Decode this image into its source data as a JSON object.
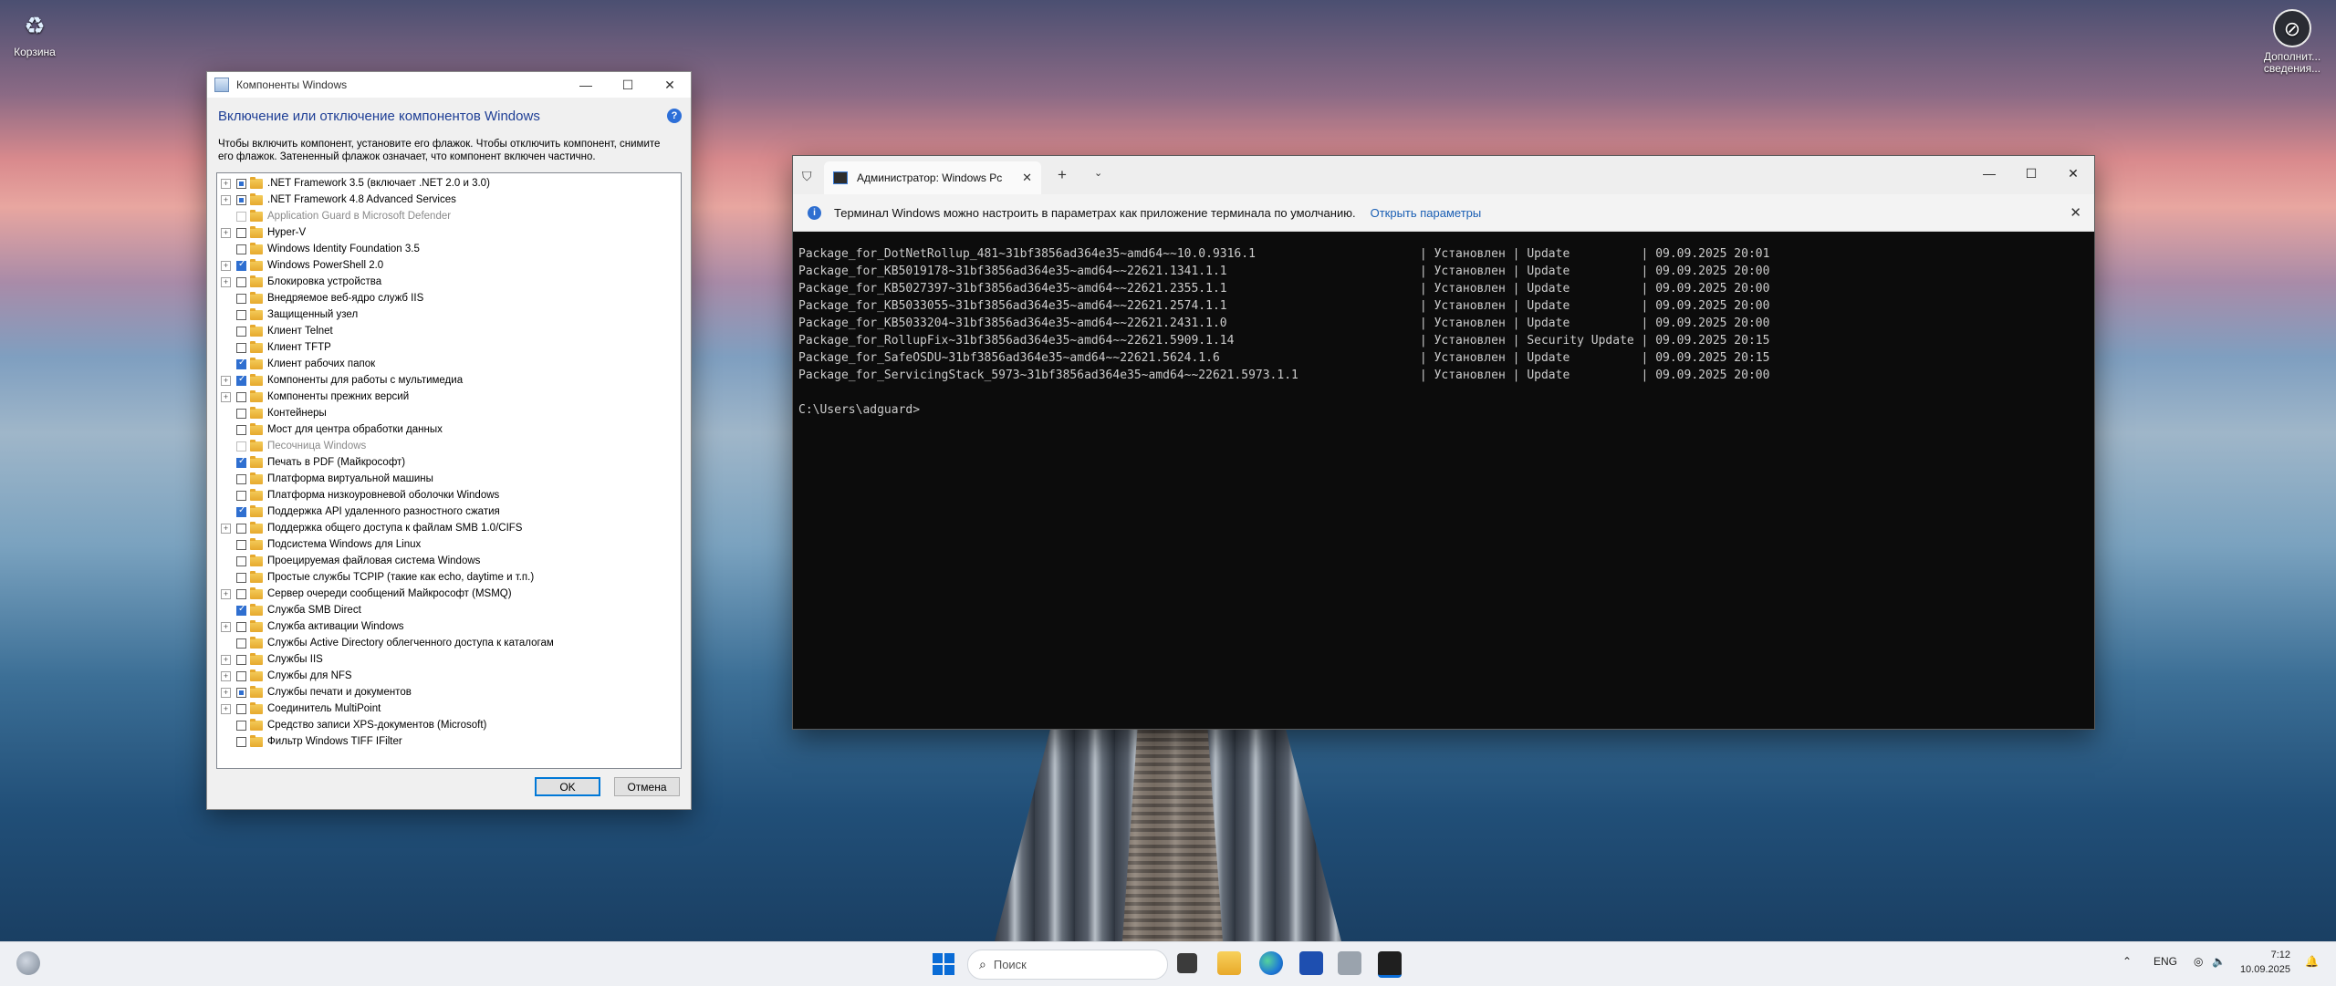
{
  "desktop": {
    "icons": [
      {
        "label": "Корзина"
      },
      {
        "label": "Дополнит... сведения..."
      }
    ]
  },
  "features_dialog": {
    "title": "Компоненты Windows",
    "heading": "Включение или отключение компонентов Windows",
    "description": "Чтобы включить компонент, установите его флажок. Чтобы отключить компонент, снимите его флажок. Затененный флажок означает, что компонент включен частично.",
    "help_glyph": "?",
    "items": [
      {
        "label": ".NET Framework 3.5 (включает .NET 2.0 и 3.0)",
        "state": "partial",
        "expandable": true
      },
      {
        "label": ".NET Framework 4.8 Advanced Services",
        "state": "partial",
        "expandable": true
      },
      {
        "label": "Application Guard в Microsoft Defender",
        "state": "disabled",
        "expandable": false
      },
      {
        "label": "Hyper-V",
        "state": "unchecked",
        "expandable": true
      },
      {
        "label": "Windows Identity Foundation 3.5",
        "state": "unchecked",
        "expandable": false
      },
      {
        "label": "Windows PowerShell 2.0",
        "state": "checked",
        "expandable": true
      },
      {
        "label": "Блокировка устройства",
        "state": "unchecked",
        "expandable": true
      },
      {
        "label": "Внедряемое веб-ядро служб IIS",
        "state": "unchecked",
        "expandable": false
      },
      {
        "label": "Защищенный узел",
        "state": "unchecked",
        "expandable": false
      },
      {
        "label": "Клиент Telnet",
        "state": "unchecked",
        "expandable": false
      },
      {
        "label": "Клиент TFTP",
        "state": "unchecked",
        "expandable": false
      },
      {
        "label": "Клиент рабочих папок",
        "state": "checked",
        "expandable": false
      },
      {
        "label": "Компоненты для работы с мультимедиа",
        "state": "checked",
        "expandable": true
      },
      {
        "label": "Компоненты прежних версий",
        "state": "unchecked",
        "expandable": true
      },
      {
        "label": "Контейнеры",
        "state": "unchecked",
        "expandable": false
      },
      {
        "label": "Мост для центра обработки данных",
        "state": "unchecked",
        "expandable": false
      },
      {
        "label": "Песочница Windows",
        "state": "disabled",
        "expandable": false
      },
      {
        "label": "Печать в PDF (Майкрософт)",
        "state": "checked",
        "expandable": false
      },
      {
        "label": "Платформа виртуальной машины",
        "state": "unchecked",
        "expandable": false
      },
      {
        "label": "Платформа низкоуровневой оболочки Windows",
        "state": "unchecked",
        "expandable": false
      },
      {
        "label": "Поддержка API удаленного разностного сжатия",
        "state": "checked",
        "expandable": false
      },
      {
        "label": "Поддержка общего доступа к файлам SMB 1.0/CIFS",
        "state": "unchecked",
        "expandable": true
      },
      {
        "label": "Подсистема Windows для Linux",
        "state": "unchecked",
        "expandable": false
      },
      {
        "label": "Проецируемая файловая система Windows",
        "state": "unchecked",
        "expandable": false
      },
      {
        "label": "Простые службы TCPIP (такие как echo, daytime и т.п.)",
        "state": "unchecked",
        "expandable": false
      },
      {
        "label": "Сервер очереди сообщений Майкрософт (MSMQ)",
        "state": "unchecked",
        "expandable": true
      },
      {
        "label": "Служба SMB Direct",
        "state": "checked",
        "expandable": false
      },
      {
        "label": "Служба активации Windows",
        "state": "unchecked",
        "expandable": true
      },
      {
        "label": "Службы Active Directory облегченного доступа к каталогам",
        "state": "unchecked",
        "expandable": false
      },
      {
        "label": "Службы IIS",
        "state": "unchecked",
        "expandable": true
      },
      {
        "label": "Службы для NFS",
        "state": "unchecked",
        "expandable": true
      },
      {
        "label": "Службы печати и документов",
        "state": "partial",
        "expandable": true
      },
      {
        "label": "Соединитель MultiPoint",
        "state": "unchecked",
        "expandable": true
      },
      {
        "label": "Средство записи XPS-документов (Microsoft)",
        "state": "unchecked",
        "expandable": false
      },
      {
        "label": "Фильтр Windows TIFF IFilter",
        "state": "unchecked",
        "expandable": false
      }
    ],
    "ok_label": "OK",
    "cancel_label": "Отмена"
  },
  "terminal": {
    "tab_title": "Администратор: Windows Pc",
    "info_message": "Терминал Windows можно настроить в параметрах как приложение терминала по умолчанию.",
    "info_link": "Открыть параметры",
    "lines": [
      "Package_for_DotNetRollup_481~31bf3856ad364e35~amd64~~10.0.9316.1                       | Установлен | Update          | 09.09.2025 20:01",
      "Package_for_KB5019178~31bf3856ad364e35~amd64~~22621.1341.1.1                           | Установлен | Update          | 09.09.2025 20:00",
      "Package_for_KB5027397~31bf3856ad364e35~amd64~~22621.2355.1.1                           | Установлен | Update          | 09.09.2025 20:00",
      "Package_for_KB5033055~31bf3856ad364e35~amd64~~22621.2574.1.1                           | Установлен | Update          | 09.09.2025 20:00",
      "Package_for_KB5033204~31bf3856ad364e35~amd64~~22621.2431.1.0                           | Установлен | Update          | 09.09.2025 20:00",
      "Package_for_RollupFix~31bf3856ad364e35~amd64~~22621.5909.1.14                          | Установлен | Security Update | 09.09.2025 20:15",
      "Package_for_SafeOSDU~31bf3856ad364e35~amd64~~22621.5624.1.6                            | Установлен | Update          | 09.09.2025 20:15",
      "Package_for_ServicingStack_5973~31bf3856ad364e35~amd64~~22621.5973.1.1                 | Установлен | Update          | 09.09.2025 20:00",
      "",
      "C:\\Users\\adguard>"
    ]
  },
  "taskbar": {
    "search_placeholder": "Поиск",
    "language": "ENG",
    "time": "7:12",
    "date": "10.09.2025"
  }
}
